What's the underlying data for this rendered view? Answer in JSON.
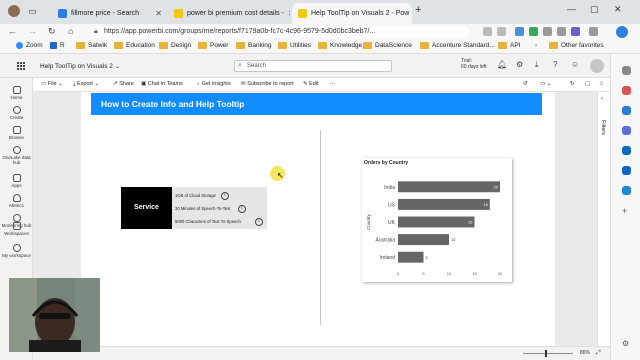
{
  "browser": {
    "tabs": [
      {
        "label": "fillmore price - Search",
        "color": "#2f7ce0"
      },
      {
        "label": "power bi premium cost details -",
        "color": "#f2c811"
      },
      {
        "label": "Help ToolTip on Visuals 2 - Pow",
        "color": "#f2c811",
        "active": true
      }
    ],
    "new_tab": "+",
    "url": "https://app.powerbi.com/groups/me/reports/f7179a0b-fc7c-4c96-9579-5d0d0bc3beb7/...",
    "favorites": [
      "Zoom",
      "R",
      "Satwik",
      "Education",
      "Design",
      "Power",
      "Banking",
      "Utilities",
      "Knowledge",
      "DataScience",
      "Accenture Standard...",
      "API",
      "Other favorites"
    ]
  },
  "pbi": {
    "report_title": "Help ToolTip on Visuals 2",
    "search_placeholder": "Search",
    "trial_line1": "Trial:",
    "trial_line2": "60 days left",
    "commands": [
      "File",
      "Export",
      "Share",
      "Chat in Teams",
      "Get insights",
      "Subscribe to report",
      "Edit",
      "⋯"
    ],
    "rail": [
      "Home",
      "Create",
      "Browse",
      "OneLake data hub",
      "Apps",
      "Metrics",
      "Monitoring hub",
      "Workspaces",
      "My workspace"
    ],
    "filters_label": "Filters",
    "zoom": "86%"
  },
  "report": {
    "banner": "How to Create Info and Help Tooltip",
    "service": {
      "label": "Service",
      "items": [
        "1GB of Cloud Storage",
        "30 Minutes of Speech-To-Text",
        "5000 Characters of Text-To-Speech"
      ]
    }
  },
  "chart_data": {
    "type": "bar",
    "orientation": "horizontal",
    "title": "Orders by Country",
    "ylabel": "Country",
    "xlabel": "",
    "categories": [
      "India",
      "US",
      "UK",
      "Australia",
      "Ireland"
    ],
    "values": [
      20,
      18,
      15,
      10,
      5
    ],
    "xlim": [
      0,
      20
    ],
    "xticks": [
      0,
      5,
      10,
      15,
      20
    ],
    "bar_color": "#666666",
    "data_labels": true,
    "grid": false
  }
}
